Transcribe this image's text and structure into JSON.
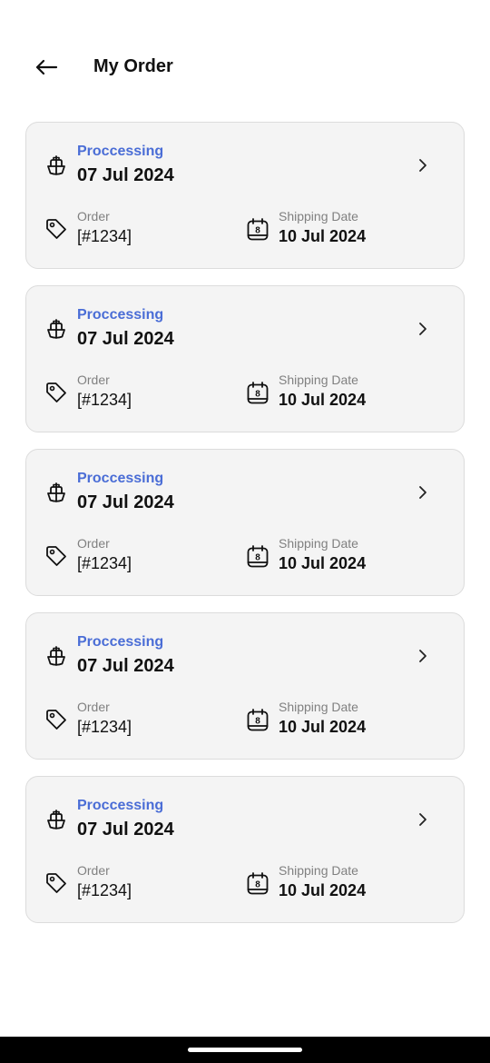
{
  "header": {
    "title": "My Order",
    "back_icon": "arrow-left-icon"
  },
  "orders": [
    {
      "status": "Proccessing",
      "date": "07 Jul 2024",
      "order_label": "Order",
      "order_number": "[#1234]",
      "shipping_label": "Shipping Date",
      "shipping_date": "10 Jul 2024"
    },
    {
      "status": "Proccessing",
      "date": "07 Jul 2024",
      "order_label": "Order",
      "order_number": "[#1234]",
      "shipping_label": "Shipping Date",
      "shipping_date": "10 Jul 2024"
    },
    {
      "status": "Proccessing",
      "date": "07 Jul 2024",
      "order_label": "Order",
      "order_number": "[#1234]",
      "shipping_label": "Shipping Date",
      "shipping_date": "10 Jul 2024"
    },
    {
      "status": "Proccessing",
      "date": "07 Jul 2024",
      "order_label": "Order",
      "order_number": "[#1234]",
      "shipping_label": "Shipping Date",
      "shipping_date": "10 Jul 2024"
    },
    {
      "status": "Proccessing",
      "date": "07 Jul 2024",
      "order_label": "Order",
      "order_number": "[#1234]",
      "shipping_label": "Shipping Date",
      "shipping_date": "10 Jul 2024"
    }
  ],
  "icons": {
    "status": "ship-icon",
    "order": "tag-icon",
    "shipping": "calendar-icon",
    "open": "chevron-right-icon",
    "calendar_day": "8"
  },
  "colors": {
    "status": "#4a6dd6",
    "card_background": "#f4f4f4",
    "label": "#808080"
  }
}
